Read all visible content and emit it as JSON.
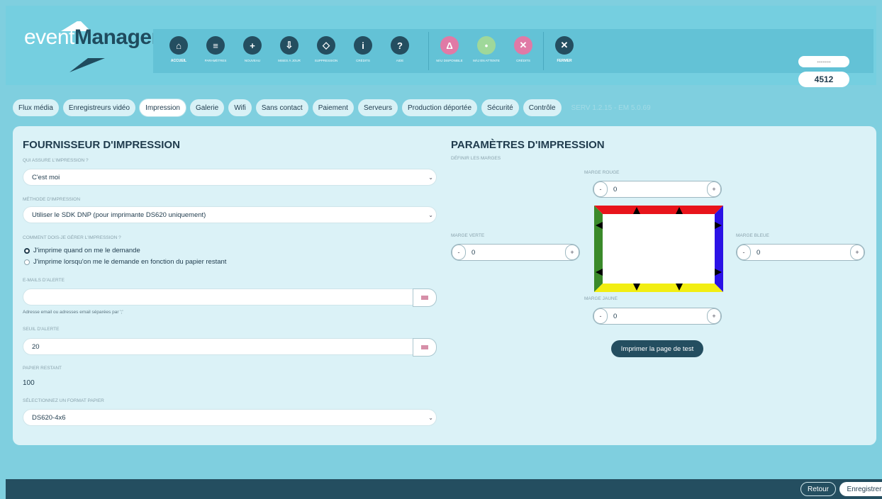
{
  "app": {
    "logo_part1": "event",
    "logo_part2": "Manager",
    "user_name": "•••••••",
    "user_number": "4512"
  },
  "toolbar": {
    "items": [
      {
        "label": "ACCUEIL",
        "icon": "home-icon",
        "glyph": "⌂"
      },
      {
        "label": "PARAMÈTRES",
        "icon": "sliders-icon",
        "glyph": "≡"
      },
      {
        "label": "NOUVEAU",
        "icon": "plus-square-icon",
        "glyph": "+"
      },
      {
        "label": "MISES À JOUR",
        "icon": "download-icon",
        "glyph": "⇩"
      },
      {
        "label": "SUPPRESSION",
        "icon": "eraser-icon",
        "glyph": "◇"
      },
      {
        "label": "CRÉDITS",
        "icon": "info-icon",
        "glyph": "i"
      },
      {
        "label": "AIDE",
        "icon": "help-icon",
        "glyph": "?"
      },
      {
        "label": "MÀJ DISPONIBLE",
        "icon": "bell-icon",
        "glyph": "Δ"
      },
      {
        "label": "MÀJ EN ATTENTE",
        "icon": "bulb-icon",
        "glyph": "•"
      },
      {
        "label": "CRÉDITS",
        "icon": "credits-icon",
        "glyph": "✕"
      },
      {
        "label": "FERMER",
        "icon": "close-icon",
        "glyph": "✕"
      }
    ]
  },
  "tabs": [
    "Flux média",
    "Enregistreurs vidéo",
    "Impression",
    "Galerie",
    "Wifi",
    "Sans contact",
    "Paiement",
    "Serveurs",
    "Production déportée",
    "Sécurité",
    "Contrôle"
  ],
  "version": "SERV 1.2.15 - EM 5.0.69",
  "left": {
    "title": "FOURNISSEUR D'IMPRESSION",
    "who_label": "QUI ASSURE L'IMPRESSION ?",
    "who_value": "C'est moi",
    "method_label": "MÉTHODE D'IMPRESSION",
    "method_value": "Utiliser le SDK DNP (pour imprimante DS620 uniquement)",
    "manage_label": "COMMENT DOIS-JE GÉRER L'IMPRESSION ?",
    "radio1": "J'imprime quand on me le demande",
    "radio2": "J'imprime lorsqu'on me le demande en fonction du papier restant",
    "emails_label": "E-MAILS D'ALERTE",
    "emails_value": "",
    "emails_help": "Adresse email ou adresses email séparées par ';'",
    "threshold_label": "SEUIL D'ALERTE",
    "threshold_value": "20",
    "paper_label": "PAPIER RESTANT",
    "paper_value": "100",
    "format_label": "SÉLECTIONNEZ UN FORMAT PAPIER",
    "format_value": "DS620-4x6"
  },
  "right": {
    "title": "PARAMÈTRES D'IMPRESSION",
    "subtitle": "DÉFINIR LES MARGES",
    "red_label": "MARGE ROUGE",
    "red_value": "0",
    "green_label": "MARGE VERTE",
    "green_value": "0",
    "blue_label": "MARGE BLEUE",
    "blue_value": "0",
    "yellow_label": "MARGE JAUNE",
    "yellow_value": "0",
    "test_button": "Imprimer la page de test"
  },
  "footer": {
    "back": "Retour",
    "save": "Enregistrer"
  },
  "colors": {
    "red": "#e8141b",
    "green": "#3a8a2a",
    "blue": "#2b12e6",
    "yellow": "#f2ee12"
  }
}
